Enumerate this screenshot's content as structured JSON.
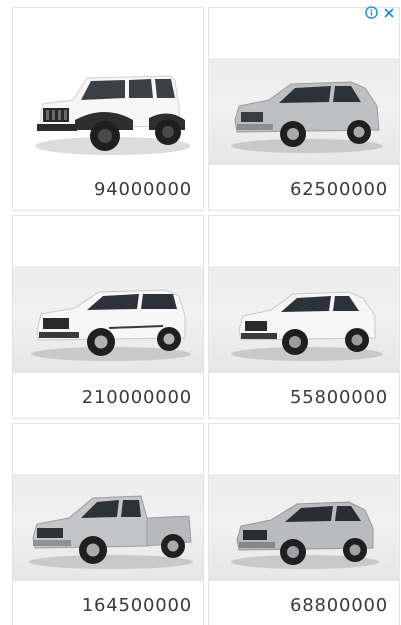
{
  "ad": {
    "choices_icon": "info-circle-icon",
    "close_icon": "close-icon",
    "accent_color": "#1a8fd0"
  },
  "listings": [
    {
      "price": "94000000",
      "vehicle_icon": "white-jeep-wrangler-image"
    },
    {
      "price": "62500000",
      "vehicle_icon": "silver-jeep-compass-image"
    },
    {
      "price": "210000000",
      "vehicle_icon": "white-toyota-fortuner-image"
    },
    {
      "price": "55800000",
      "vehicle_icon": "white-jeep-compass-image"
    },
    {
      "price": "164500000",
      "vehicle_icon": "silver-toyota-hilux-image"
    },
    {
      "price": "68800000",
      "vehicle_icon": "silver-ford-edge-image"
    }
  ]
}
